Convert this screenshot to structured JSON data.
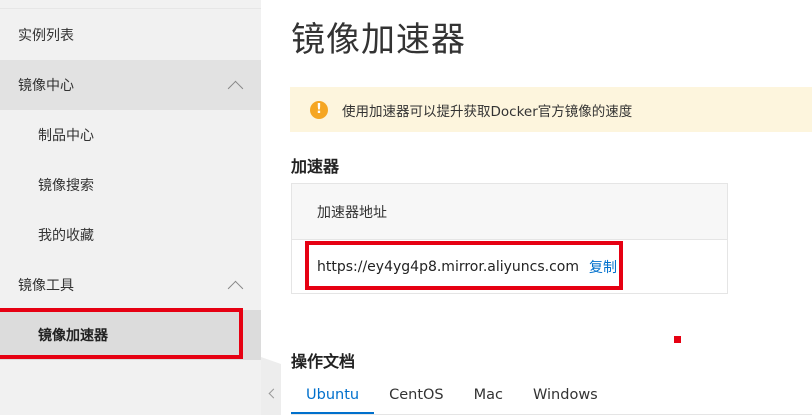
{
  "sidebar": {
    "items": [
      {
        "label": "实例列表"
      },
      {
        "label": "镜像中心"
      },
      {
        "label": "制品中心"
      },
      {
        "label": "镜像搜索"
      },
      {
        "label": "我的收藏"
      },
      {
        "label": "镜像工具"
      },
      {
        "label": "镜像加速器"
      }
    ]
  },
  "main": {
    "title": "镜像加速器",
    "notice": "使用加速器可以提升获取Docker官方镜像的速度",
    "accelerator": {
      "section_title": "加速器",
      "column_header": "加速器地址",
      "address": "https://ey4yg4p8.mirror.aliyuncs.com",
      "copy_label": "复制"
    },
    "docs": {
      "section_title": "操作文档",
      "tabs": [
        {
          "label": "Ubuntu",
          "active": true
        },
        {
          "label": "CentOS",
          "active": false
        },
        {
          "label": "Mac",
          "active": false
        },
        {
          "label": "Windows",
          "active": false
        }
      ]
    }
  },
  "colors": {
    "accent": "#0070cc",
    "highlight": "#e60012",
    "notice_bg": "#fdf5dd",
    "warning": "#f5a623"
  },
  "icons": {
    "notice": "warning-icon",
    "group_toggle": "chevron-up-icon",
    "collapse": "chevron-left-icon"
  }
}
